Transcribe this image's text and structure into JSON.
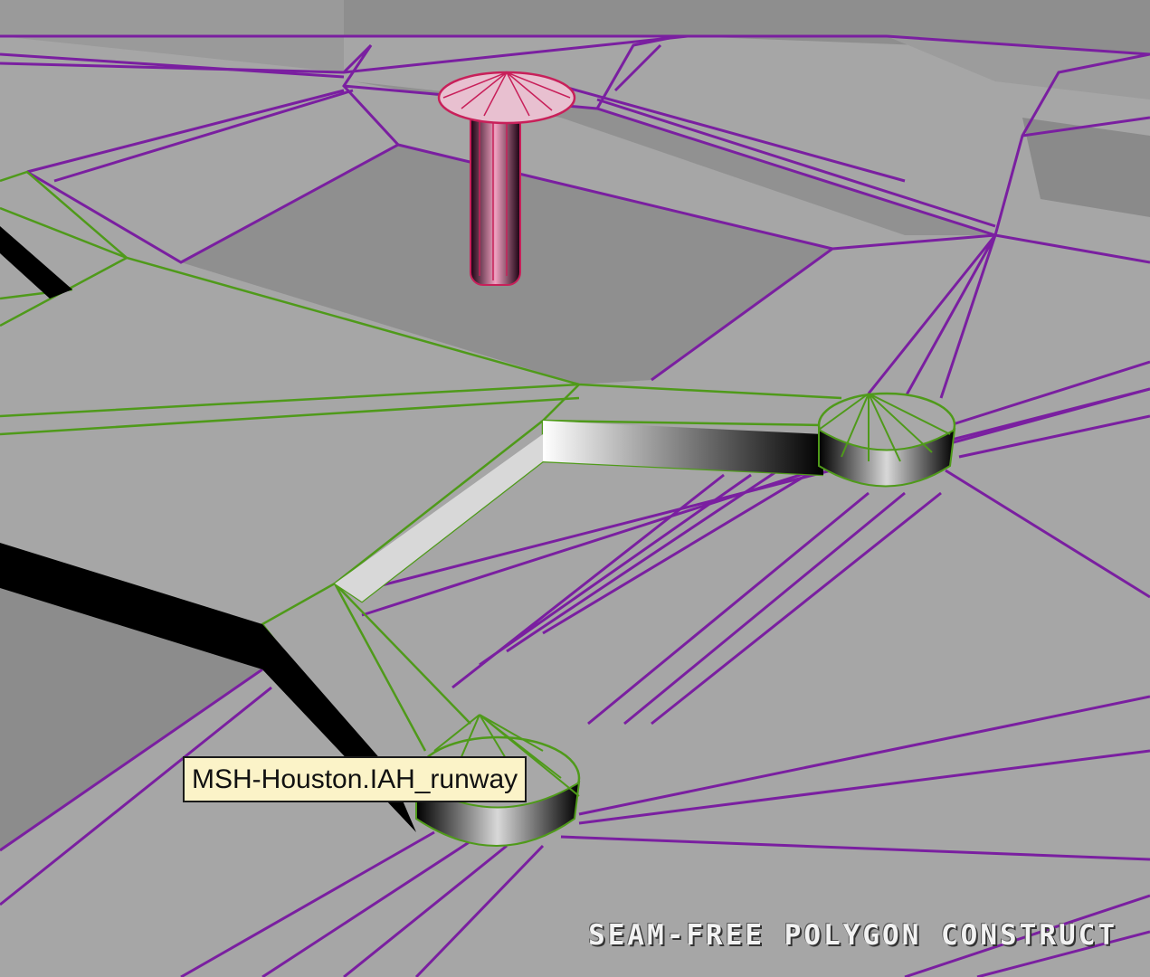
{
  "viewport": {
    "tooltip_text": "MSH-Houston.IAH_runway",
    "caption": "SEAM-FREE POLYGON CONSTRUCT"
  },
  "colors": {
    "background": "#a3a3a3",
    "wireframe_terrain": "#7a1fa0",
    "wireframe_selected": "#4f9a1a",
    "marker": "#c8205a",
    "tooltip_bg": "#fbf3c8"
  },
  "icons": {
    "marker": "pin-marker-icon"
  }
}
